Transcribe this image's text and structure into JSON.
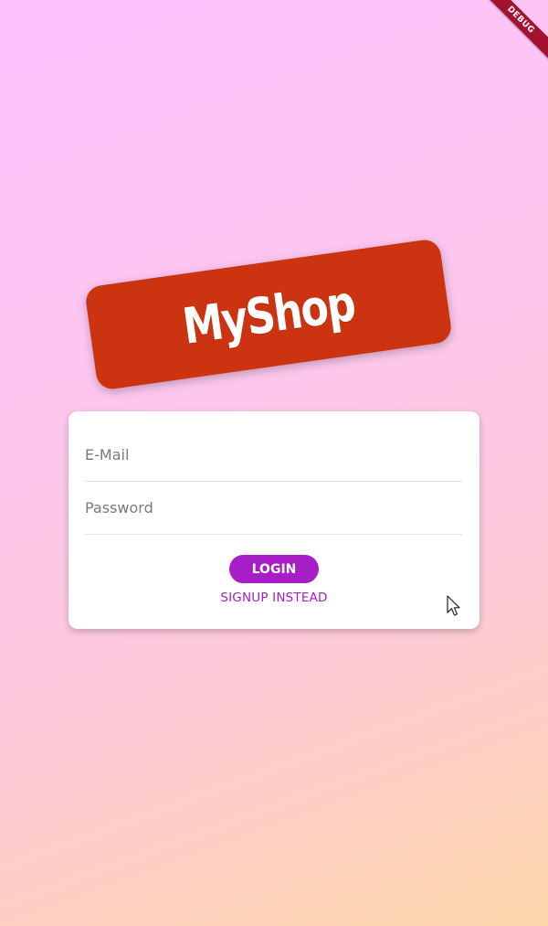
{
  "debug_banner": {
    "label": "DEBUG"
  },
  "logo": {
    "text": "MyShop"
  },
  "auth_form": {
    "email": {
      "placeholder": "E-Mail",
      "value": ""
    },
    "password": {
      "placeholder": "Password",
      "value": ""
    },
    "login_label": "LOGIN",
    "signup_label": "SIGNUP INSTEAD"
  },
  "colors": {
    "background_top": "#fcc0fd",
    "background_bottom": "#fdd6aa",
    "logo_background": "#cc3310",
    "accent": "#a71dc6",
    "card": "#ffffff"
  },
  "icons": {
    "cursor": "mouse-pointer-icon"
  }
}
